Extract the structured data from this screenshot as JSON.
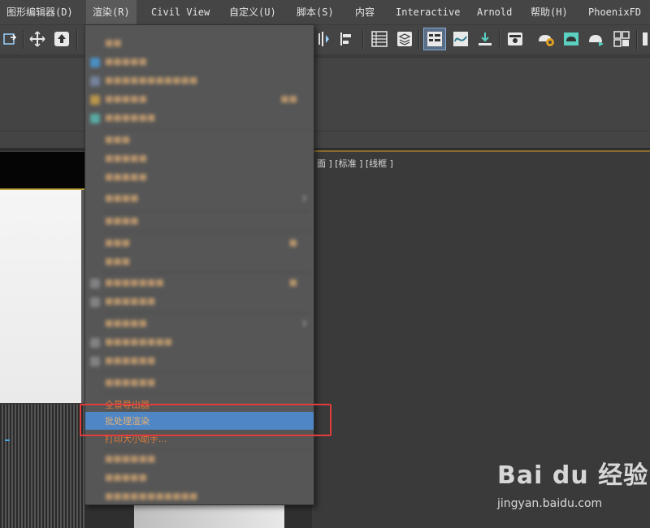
{
  "menubar": {
    "items": [
      {
        "label": "图形编辑器(D)"
      },
      {
        "label": "渲染(R)"
      },
      {
        "label": "Civil View"
      },
      {
        "label": "自定义(U)"
      },
      {
        "label": "脚本(S)"
      },
      {
        "label": "内容"
      },
      {
        "label": "Interactive"
      },
      {
        "label": "Arnold"
      },
      {
        "label": "帮助(H)"
      },
      {
        "label": "PhoenixFD"
      }
    ],
    "active": "渲染(R)"
  },
  "toolbar": {
    "icons": [
      "move-snap-icon",
      "move-icon",
      "select-upload-icon",
      "mirror-icon",
      "align-icon",
      "scene-explorer-icon",
      "layer-explorer-icon",
      "toggle-ribbon-icon",
      "curve-editor-icon",
      "schematic-view-icon",
      "material-editor-icon",
      "render-setup-icon",
      "rendered-frame-window-icon",
      "render-production-icon",
      "render-iterative-icon"
    ],
    "selected_icon": "toggle-ribbon-icon"
  },
  "viewport": {
    "label": "[标准 ]  [线框 ]",
    "label_prefix": "面 ]"
  },
  "dropdown": {
    "visible_items": [
      {
        "label": "全景导出器"
      },
      {
        "label": "批处理渲染",
        "highlighted": true
      },
      {
        "label": "打印大小助手..."
      }
    ],
    "accent": "#e07a3a",
    "highlight_color": "#4e86c6"
  },
  "watermark": {
    "logo": "Bai du 经验",
    "sub": "jingyan.baidu.com"
  },
  "colors": {
    "highlight": "#e23c3c"
  }
}
